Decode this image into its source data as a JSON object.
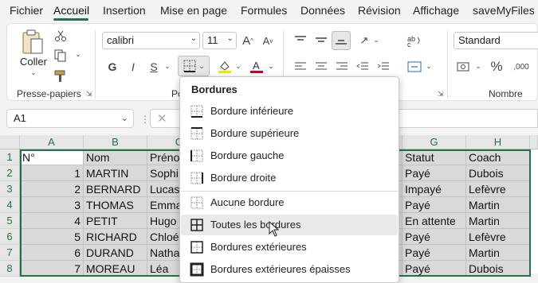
{
  "menu": {
    "tabs": [
      "Fichier",
      "Accueil",
      "Insertion",
      "Mise en page",
      "Formules",
      "Données",
      "Révision",
      "Affichage",
      "saveMyFiles"
    ]
  },
  "ribbon": {
    "clipboard": {
      "paste_label": "Coller",
      "group_label": "Presse-papiers"
    },
    "font": {
      "name": "calibri",
      "size": "11",
      "bold": "G",
      "italic": "I",
      "underline": "S",
      "group_label_partial": "Po"
    },
    "number": {
      "format": "Standard",
      "group_label": "Nombre",
      "percent": "%"
    },
    "accent_color": "#217346"
  },
  "formula_bar": {
    "name_box": "A1",
    "value": ""
  },
  "sheet": {
    "columns": [
      "A",
      "B",
      "C",
      "D",
      "E",
      "F",
      "G",
      "H"
    ],
    "row_numbers": [
      "1",
      "2",
      "3",
      "4",
      "5",
      "6",
      "7",
      "8"
    ],
    "headers": {
      "A": "N°",
      "B": "Nom",
      "C": "Préno",
      "G": "Statut",
      "H": "Coach"
    },
    "rows": [
      {
        "A": "1",
        "B": "MARTIN",
        "C": "Sophi",
        "G": "Payé",
        "H": "Dubois"
      },
      {
        "A": "2",
        "B": "BERNARD",
        "C": "Lucas",
        "G": "Impayé",
        "H": "Lefèvre"
      },
      {
        "A": "3",
        "B": "THOMAS",
        "C": "Emma",
        "G": "Payé",
        "H": "Martin"
      },
      {
        "A": "4",
        "B": "PETIT",
        "C": "Hugo",
        "G": "En attente",
        "H": "Martin"
      },
      {
        "A": "5",
        "B": "RICHARD",
        "C": "Chloé",
        "G": "Payé",
        "H": "Lefèvre"
      },
      {
        "A": "6",
        "B": "DURAND",
        "C": "Natha",
        "G": "Payé",
        "H": "Martin"
      },
      {
        "A": "7",
        "B": "MOREAU",
        "C": "Léa",
        "G": "Payé",
        "H": "Dubois"
      }
    ]
  },
  "borders_menu": {
    "title": "Bordures",
    "items": [
      {
        "label": "Bordure inférieure",
        "icon": "border-bottom-icon"
      },
      {
        "label": "Bordure supérieure",
        "icon": "border-top-icon"
      },
      {
        "label": "Bordure gauche",
        "icon": "border-left-icon"
      },
      {
        "label": "Bordure droite",
        "icon": "border-right-icon"
      },
      {
        "label": "Aucune bordure",
        "icon": "no-border-icon"
      },
      {
        "label": "Toutes les bordures",
        "icon": "all-borders-icon"
      },
      {
        "label": "Bordures extérieures",
        "icon": "outside-borders-icon"
      },
      {
        "label": "Bordures extérieures épaisses",
        "icon": "thick-outside-borders-icon"
      }
    ]
  }
}
